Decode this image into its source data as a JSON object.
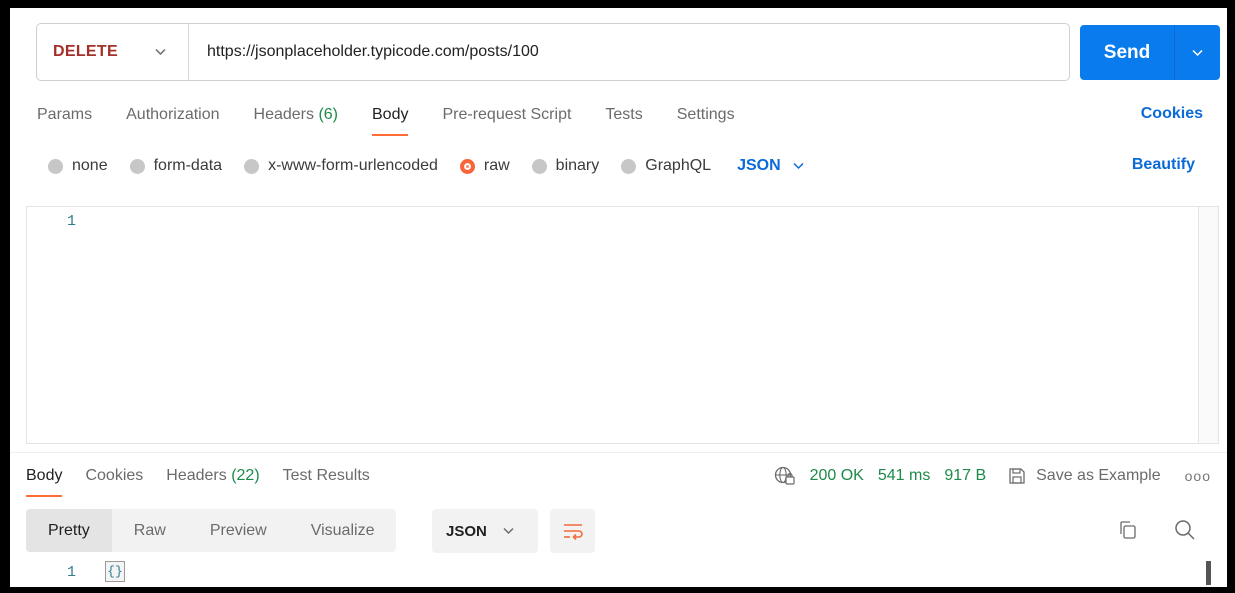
{
  "request": {
    "method": "DELETE",
    "url": "https://jsonplaceholder.typicode.com/posts/100",
    "send_label": "Send"
  },
  "request_tabs": [
    {
      "label": "Params",
      "count": ""
    },
    {
      "label": "Authorization",
      "count": ""
    },
    {
      "label": "Headers ",
      "count": "(6)"
    },
    {
      "label": "Body",
      "count": "",
      "active": true
    },
    {
      "label": "Pre-request Script",
      "count": ""
    },
    {
      "label": "Tests",
      "count": ""
    },
    {
      "label": "Settings",
      "count": ""
    }
  ],
  "cookies_label": "Cookies",
  "body_options": {
    "items": [
      "none",
      "form-data",
      "x-www-form-urlencoded",
      "raw",
      "binary",
      "GraphQL"
    ],
    "selected": "raw",
    "format": "JSON",
    "beautify_label": "Beautify"
  },
  "editor": {
    "line_number": "1"
  },
  "response_tabs": [
    {
      "label": "Body",
      "count": "",
      "active": true
    },
    {
      "label": "Cookies",
      "count": ""
    },
    {
      "label": "Headers ",
      "count": "(22)"
    },
    {
      "label": "Test Results",
      "count": ""
    }
  ],
  "response_status": {
    "status": "200 OK",
    "time": "541 ms",
    "size": "917 B",
    "save_label": "Save as Example",
    "more": "ooo"
  },
  "response_view": {
    "modes": [
      "Pretty",
      "Raw",
      "Preview",
      "Visualize"
    ],
    "active": "Pretty",
    "format": "JSON",
    "line_number": "1",
    "content": "{}"
  },
  "colors": {
    "accent": "#ff6c37",
    "link": "#0b6bd7",
    "send": "#097bed",
    "status_ok": "#1e8a4a",
    "method_delete": "#a5302b"
  }
}
